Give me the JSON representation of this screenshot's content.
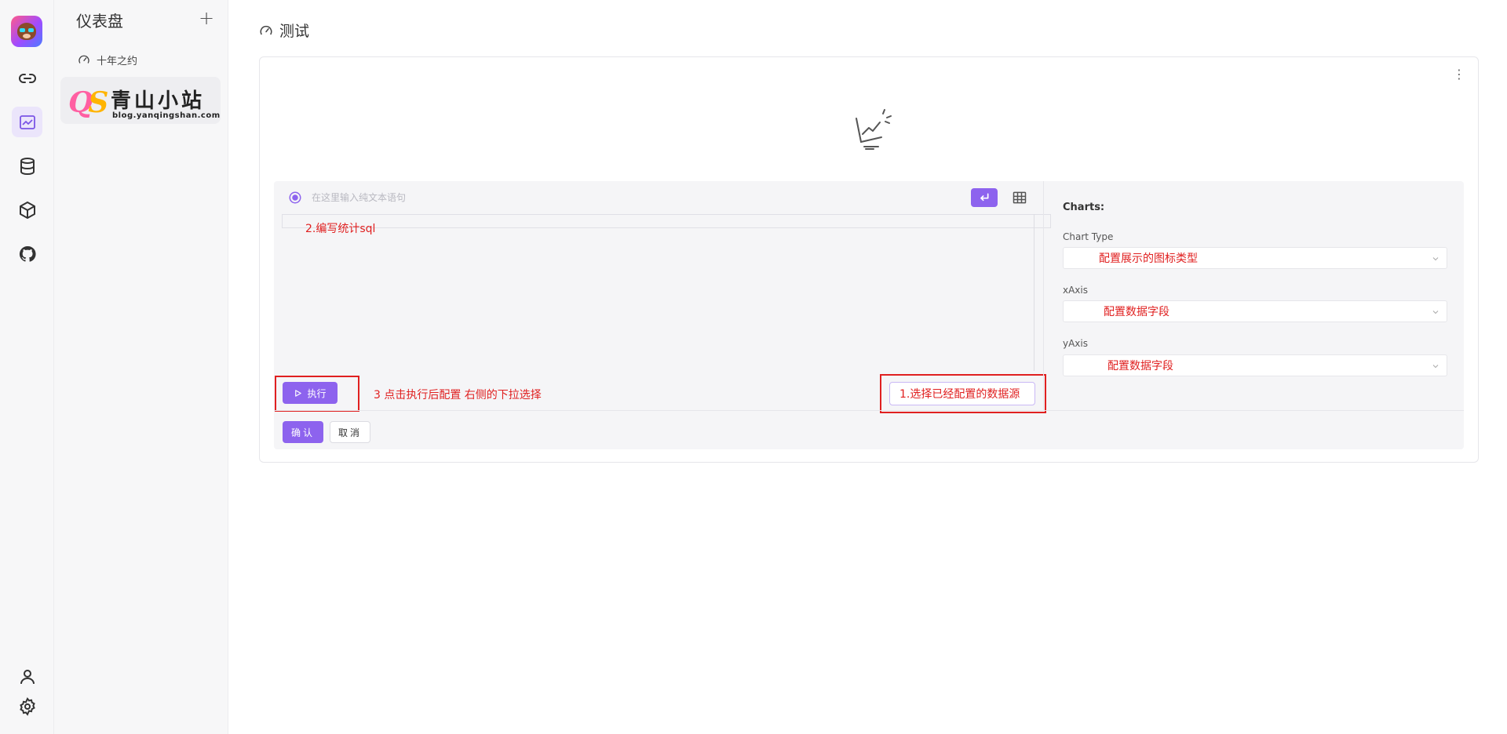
{
  "sidebar": {
    "rail_icons": [
      "logo",
      "link-icon",
      "chart-icon",
      "database-icon",
      "cube-icon",
      "github-icon",
      "user-icon",
      "gear-icon"
    ],
    "panel_title": "仪表盘",
    "add_label": "+",
    "items": [
      {
        "label": "十年之约",
        "icon": "dashboard-gauge-icon"
      }
    ],
    "brand": {
      "mark_q": "Q",
      "mark_s": "S",
      "name": "青山小站",
      "url": "blog.yanqingshan.com"
    }
  },
  "main": {
    "title": "测试",
    "more_label": "⋮",
    "query": {
      "placeholder": "在这里输入纯文本语句"
    },
    "sql_note": "2.编写统计sql",
    "run_label": "执行",
    "run_note": "3 点击执行后配置 右侧的下拉选择",
    "datasource_note": "1.选择已经配置的数据源",
    "ok_label": "确认",
    "cancel_label": "取消"
  },
  "charts": {
    "title": "Charts:",
    "chart_type_label": "Chart Type",
    "chart_type_value": "配置展示的图标类型",
    "xaxis_label": "xAxis",
    "xaxis_value": "配置数据字段",
    "yaxis_label": "yAxis",
    "yaxis_value": "配置数据字段"
  },
  "colors": {
    "accent": "#8d63ee",
    "annotation": "#e02020"
  }
}
